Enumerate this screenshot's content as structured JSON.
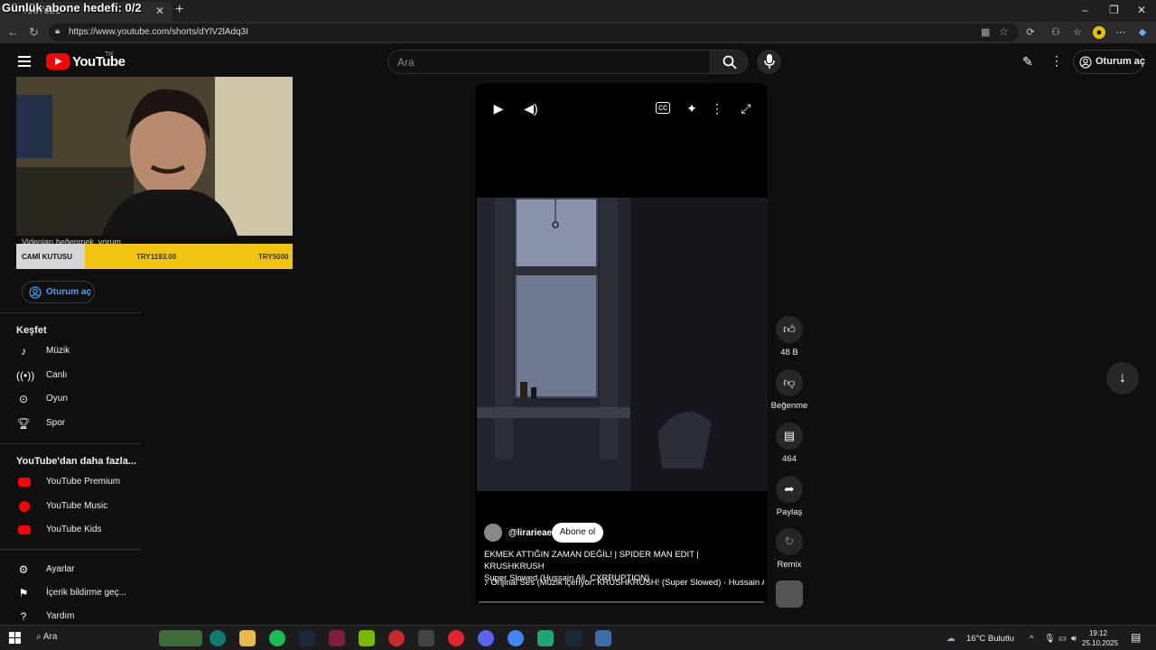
{
  "overlay": {
    "text": "Günlük abone hedefi: 0/2"
  },
  "browser": {
    "tab_title": "YouTube",
    "url": "https://www.youtube.com/shorts/dYlV2lAdq3I",
    "window_controls": [
      "–",
      "❐",
      "✕"
    ]
  },
  "header": {
    "logo_text": "YouTube",
    "logo_region": "TR",
    "search_placeholder": "Ara",
    "signin_label": "Oturum aç"
  },
  "stream": {
    "donation_label": "CAMİ KUTUSU",
    "donation_current": "TRY1193.00",
    "donation_goal": "TRY5000",
    "under_text": "Videoları beğenmek, yorum"
  },
  "sidebar": {
    "signin_label": "Oturum aç",
    "explore_title": "Keşfet",
    "explore_items": [
      {
        "label": "Müzik",
        "icon": "music-note-icon"
      },
      {
        "label": "Canlı",
        "icon": "live-icon"
      },
      {
        "label": "Oyun",
        "icon": "gamepad-icon"
      },
      {
        "label": "Spor",
        "icon": "trophy-icon"
      }
    ],
    "more_title": "YouTube'dan daha fazla...",
    "more_items": [
      {
        "label": "YouTube Premium"
      },
      {
        "label": "YouTube Music"
      },
      {
        "label": "YouTube Kids"
      }
    ],
    "settings_items": [
      {
        "label": "Ayarlar",
        "icon": "gear-icon"
      },
      {
        "label": "İçerik bildirme geç...",
        "icon": "flag-icon"
      },
      {
        "label": "Yardım",
        "icon": "help-icon"
      }
    ]
  },
  "short": {
    "channel": "@lirarieae",
    "subscribe_label": "Abone ol",
    "title_line1": "EKMEK ATTIĞIN ZAMAN DEĞİL! | SPIDER MAN EDIT | KRUSHKRUSH",
    "title_line2": "Super Slowed (Hussain Ali, CXRRUPTION)",
    "audio": "Orijinal Ses (Müzik içeriyor: KRUSHKRUSH! (Super Slowed) · Hussain A"
  },
  "actions": {
    "likes": "48 B",
    "dislike_label": "Beğenme",
    "comments": "464",
    "share_label": "Paylaş",
    "remix_label": "Remix"
  },
  "taskbar": {
    "search_label": "Ara",
    "weather": "16°C  Bulutlu",
    "time": "19:12",
    "date": "25.10.2025"
  }
}
